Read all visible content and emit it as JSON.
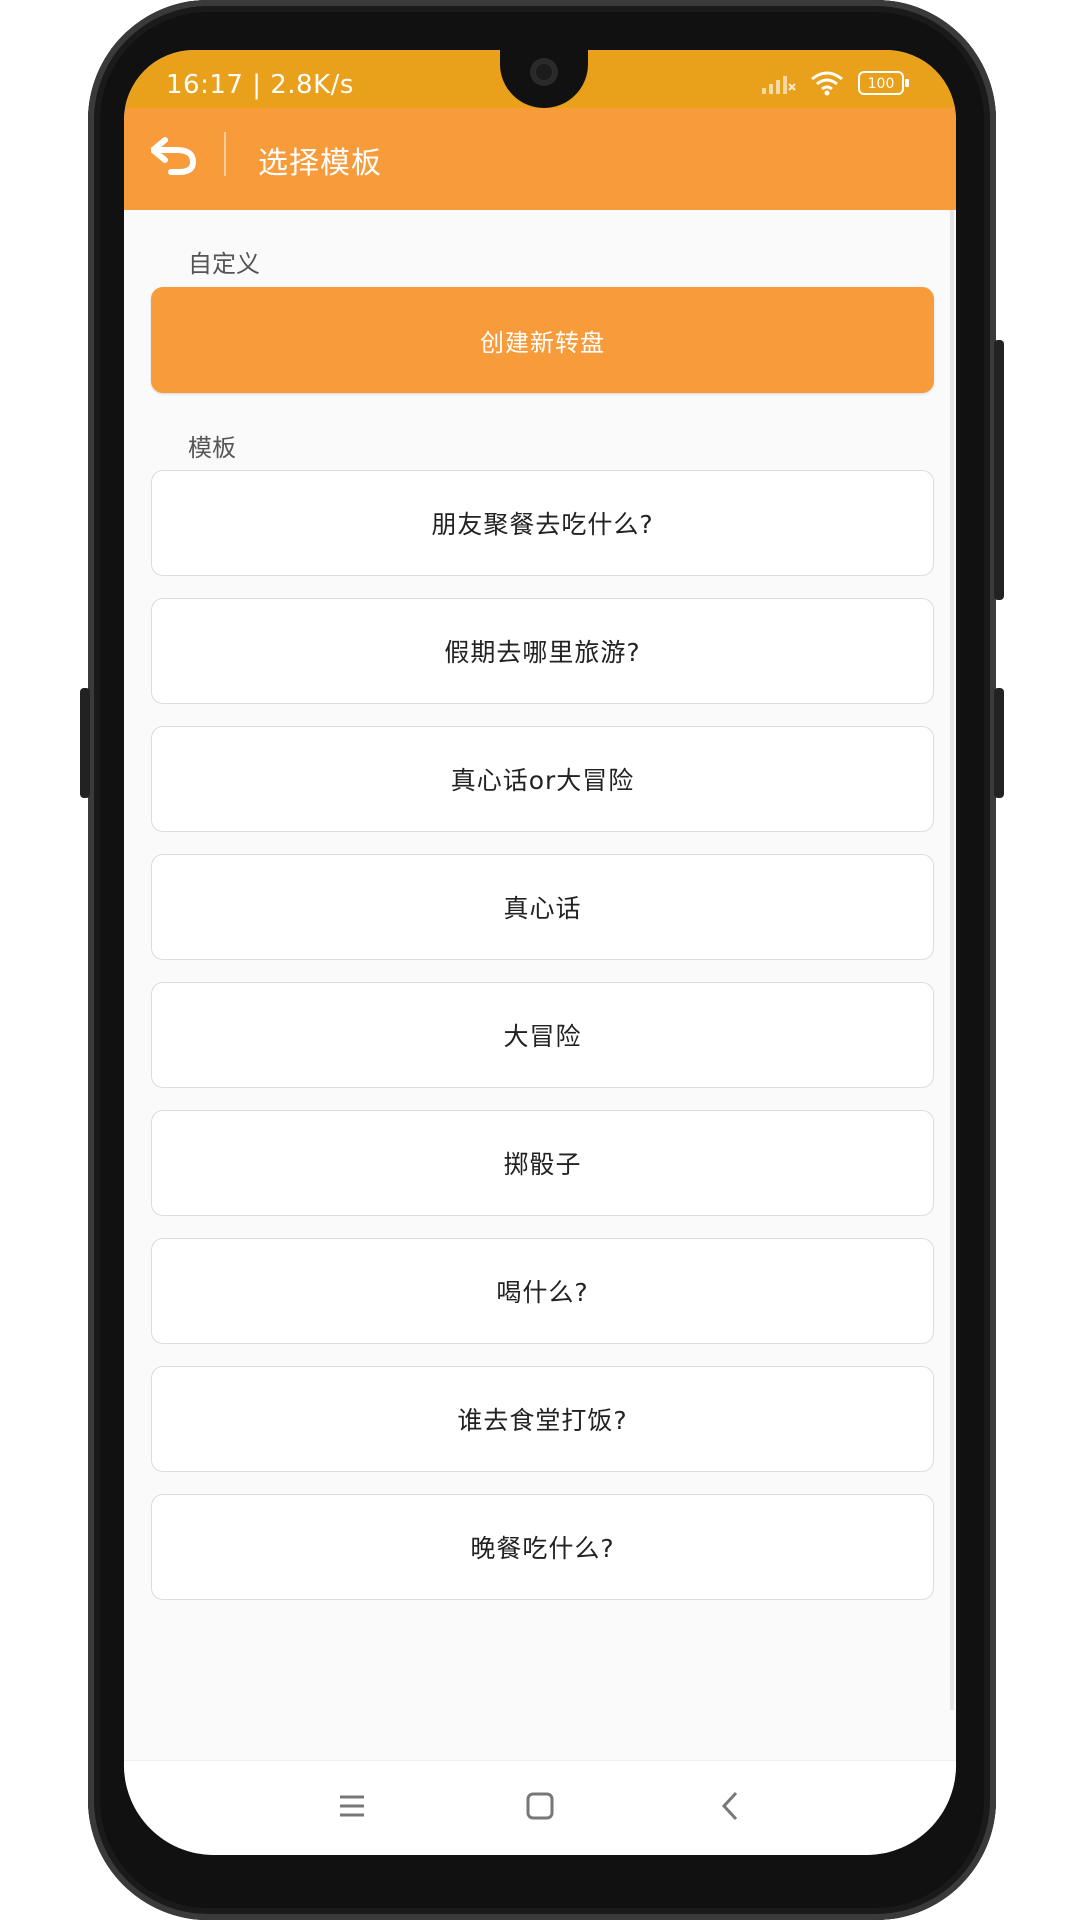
{
  "status": {
    "time": "16:17 | 2.8K/s",
    "battery": "100"
  },
  "appbar": {
    "title": "选择模板"
  },
  "sections": {
    "custom_label": "自定义",
    "templates_label": "模板"
  },
  "create_button": {
    "label": "创建新转盘"
  },
  "templates": [
    "朋友聚餐去吃什么?",
    "假期去哪里旅游?",
    "真心话or大冒险",
    "真心话",
    "大冒险",
    "掷骰子",
    "喝什么?",
    "谁去食堂打饭?",
    "晚餐吃什么?"
  ],
  "colors": {
    "status_bar": "#e9a01a",
    "accent": "#f79b3b",
    "background": "#fafafa"
  }
}
